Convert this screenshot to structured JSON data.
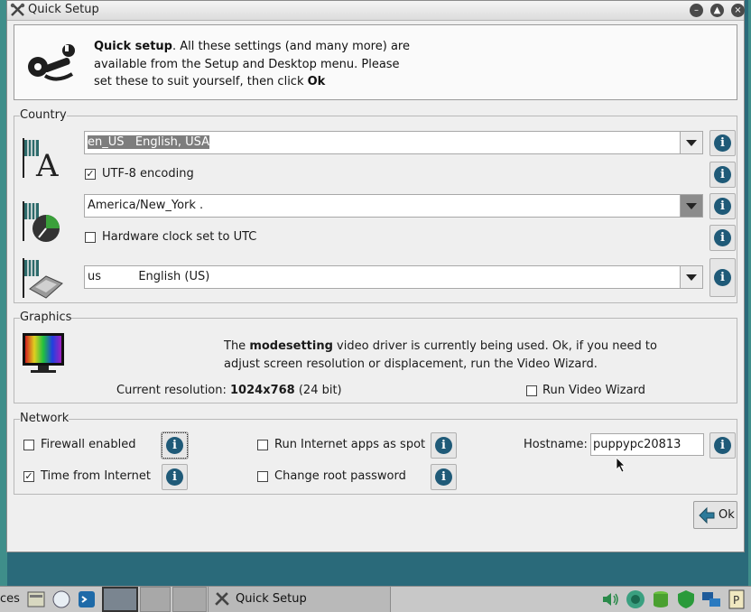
{
  "window": {
    "title": "Quick Setup",
    "buttons": [
      "minimize",
      "maximize",
      "close"
    ]
  },
  "header": {
    "bold": "Quick setup",
    "text1": ". All these settings (and many more) are",
    "text2": "available from the Setup and Desktop menu. Please",
    "text3": "set these to suit yourself, then click ",
    "ok_word": "Ok"
  },
  "country": {
    "label": "Country",
    "locale_value": "en_US   English, USA",
    "utf8_label": "UTF-8 encoding",
    "utf8_checked": true,
    "timezone_value": "America/New_York .",
    "hwclock_label": "Hardware clock set to UTC",
    "hwclock_checked": false,
    "keyboard_value": "us          English (US)"
  },
  "graphics": {
    "label": "Graphics",
    "text_prefix": "The ",
    "driver": "modesetting",
    "text_suffix": " video driver is currently being used. Ok, if you need to",
    "text_line2": "adjust screen resolution or displacement, run the Video Wizard.",
    "resolution_label": "Current resolution: ",
    "resolution_value": "1024x768",
    "depth": "  (24 bit)",
    "wizard_label": "Run Video Wizard",
    "wizard_checked": false
  },
  "network": {
    "label": "Network",
    "firewall_label": "Firewall enabled",
    "firewall_checked": false,
    "spot_label": "Run Internet apps as spot",
    "spot_checked": false,
    "hostname_label": "Hostname:",
    "hostname_value": "puppypc20813",
    "time_label": "Time from Internet",
    "time_checked": true,
    "rootpw_label": "Change root password",
    "rootpw_checked": false
  },
  "ok_button": "Ok",
  "taskbar": {
    "left_text": "ces",
    "active_task": "Quick Setup"
  },
  "colors": {
    "info": "#1f5a78",
    "desktop": "#2a6a7a"
  }
}
